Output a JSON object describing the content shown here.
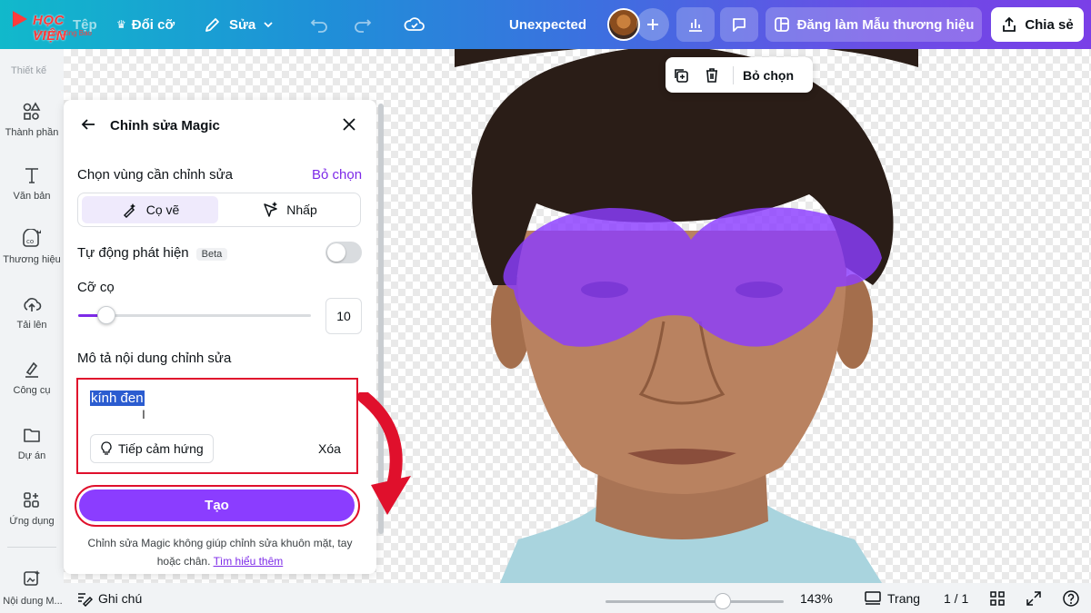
{
  "topbar": {
    "logo_text": "HỌC VIỆN",
    "logo_sub": "Vinh Xi Công Bao",
    "file": "Tệp",
    "resize": "Đổi cỡ",
    "edit": "Sửa",
    "title": "Unexpected",
    "brand_button": "Đăng làm Mẫu thương hiệu",
    "share_button": "Chia sẻ"
  },
  "rail": {
    "header": "Thiết kế",
    "items": [
      {
        "label": "Thành phần",
        "icon": "elements-icon"
      },
      {
        "label": "Văn bản",
        "icon": "text-icon"
      },
      {
        "label": "Thương hiệu",
        "icon": "brand-icon"
      },
      {
        "label": "Tải lên",
        "icon": "upload-icon"
      },
      {
        "label": "Công cụ",
        "icon": "tools-icon"
      },
      {
        "label": "Dự án",
        "icon": "folder-icon"
      },
      {
        "label": "Ứng dụng",
        "icon": "apps-icon"
      }
    ],
    "bottom_item": "Nội dung M..."
  },
  "floating_bar": {
    "deselect": "Bỏ chọn"
  },
  "panel": {
    "title": "Chỉnh sửa Magic",
    "select_area_label": "Chọn vùng cần chỉnh sửa",
    "deselect_link": "Bỏ chọn",
    "mode_brush": "Cọ vẽ",
    "mode_click": "Nhấp",
    "auto_detect": "Tự động phát hiện",
    "beta": "Beta",
    "auto_detect_on": false,
    "brush_size_label": "Cỡ cọ",
    "brush_size_value": "10",
    "brush_size_fraction": 0.12,
    "describe_label": "Mô tả nội dung chỉnh sửa",
    "prompt_value": "kính đen",
    "inspire_button": "Tiếp cảm hứng",
    "clear_button": "Xóa",
    "create_button": "Tạo",
    "note": "Chỉnh sửa Magic không giúp chỉnh sửa khuôn mặt, tay hoặc chân.",
    "learn_more": "Tìm hiểu thêm"
  },
  "bottombar": {
    "notes": "Ghi chú",
    "zoom": "143%",
    "zoom_fraction": 0.66,
    "pages_label": "Trang",
    "page_count": "1 / 1"
  },
  "colors": {
    "accent": "#7d2ae8",
    "create_button": "#8b3dff",
    "annotation_red": "#e0102c",
    "brush_overlay": "#8b3dff"
  }
}
